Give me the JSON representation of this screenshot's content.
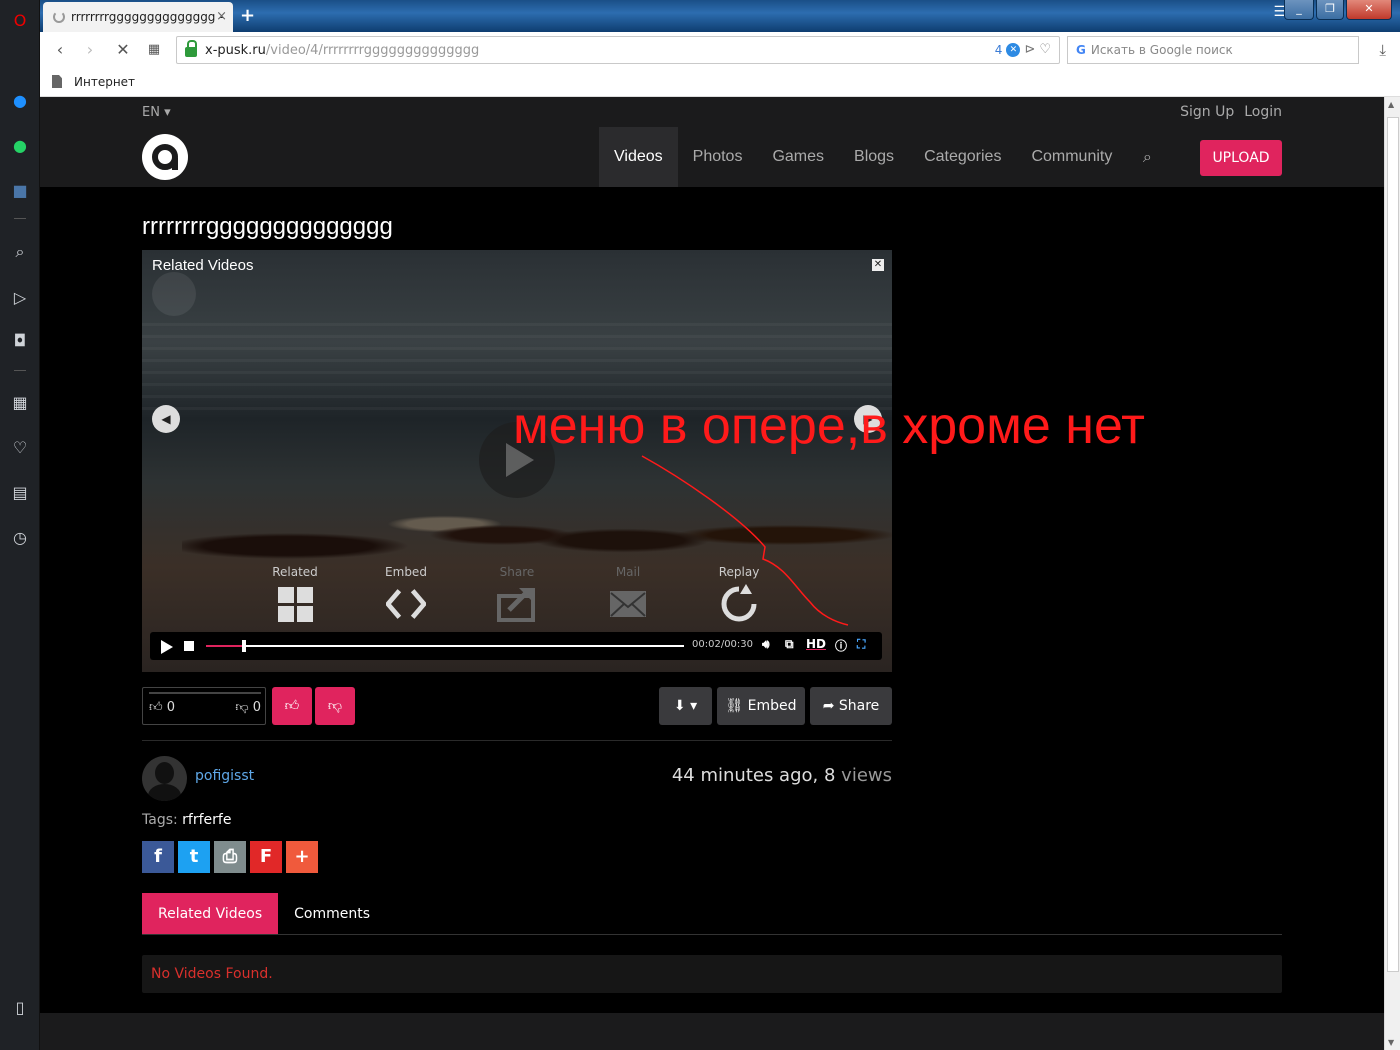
{
  "browser": {
    "tab_title": "rrrrrrrrgggggggggggggg - ",
    "tab_close": "×",
    "new_tab": "+",
    "url_host": "x-pusk.ru",
    "url_path": "/video/4/rrrrrrrrgggggggggggggg",
    "badge_count": "4",
    "search_placeholder": "Искать в Google поиск",
    "search_g": "G",
    "bookmark": "Интернет",
    "window_buttons": [
      "_",
      "❐",
      "✕"
    ]
  },
  "site": {
    "lang": "EN ▾",
    "sign_up": "Sign Up",
    "login": "Login",
    "menu": [
      "Videos",
      "Photos",
      "Games",
      "Blogs",
      "Categories",
      "Community"
    ],
    "upload": "UPLOAD"
  },
  "video": {
    "title": "rrrrrrrrgggggggggggggg",
    "overlay_title": "Related Videos",
    "close_glyph": "✕",
    "share_items": [
      {
        "label": "Related"
      },
      {
        "label": "Embed"
      },
      {
        "label": "Share"
      },
      {
        "label": "Mail"
      },
      {
        "label": "Replay"
      }
    ],
    "time": "00:02/00:30",
    "progress": 0.08,
    "hd": "HD",
    "annotation": "меню в опере,в хроме нет"
  },
  "actions": {
    "likes": "0",
    "dislikes": "0",
    "embed": "Embed",
    "share": "Share",
    "download_glyph": "⬇ ▾"
  },
  "info": {
    "username": "pofigisst",
    "time_ago": "44 minutes ago",
    "views_count": "8",
    "views_word": "views",
    "tags_label": "Tags:",
    "tag": "rfrferfe"
  },
  "social": [
    {
      "name": "facebook",
      "glyph": "f",
      "color": "#3b5998"
    },
    {
      "name": "twitter",
      "glyph": "t",
      "color": "#1da1f2"
    },
    {
      "name": "print",
      "glyph": "⎙",
      "color": "#7f8c8d"
    },
    {
      "name": "flipboard",
      "glyph": "F",
      "color": "#e12828"
    },
    {
      "name": "more",
      "glyph": "+",
      "color": "#f05a3c"
    }
  ],
  "tabs": [
    "Related Videos",
    "Comments"
  ],
  "empty_message": "No Videos Found."
}
